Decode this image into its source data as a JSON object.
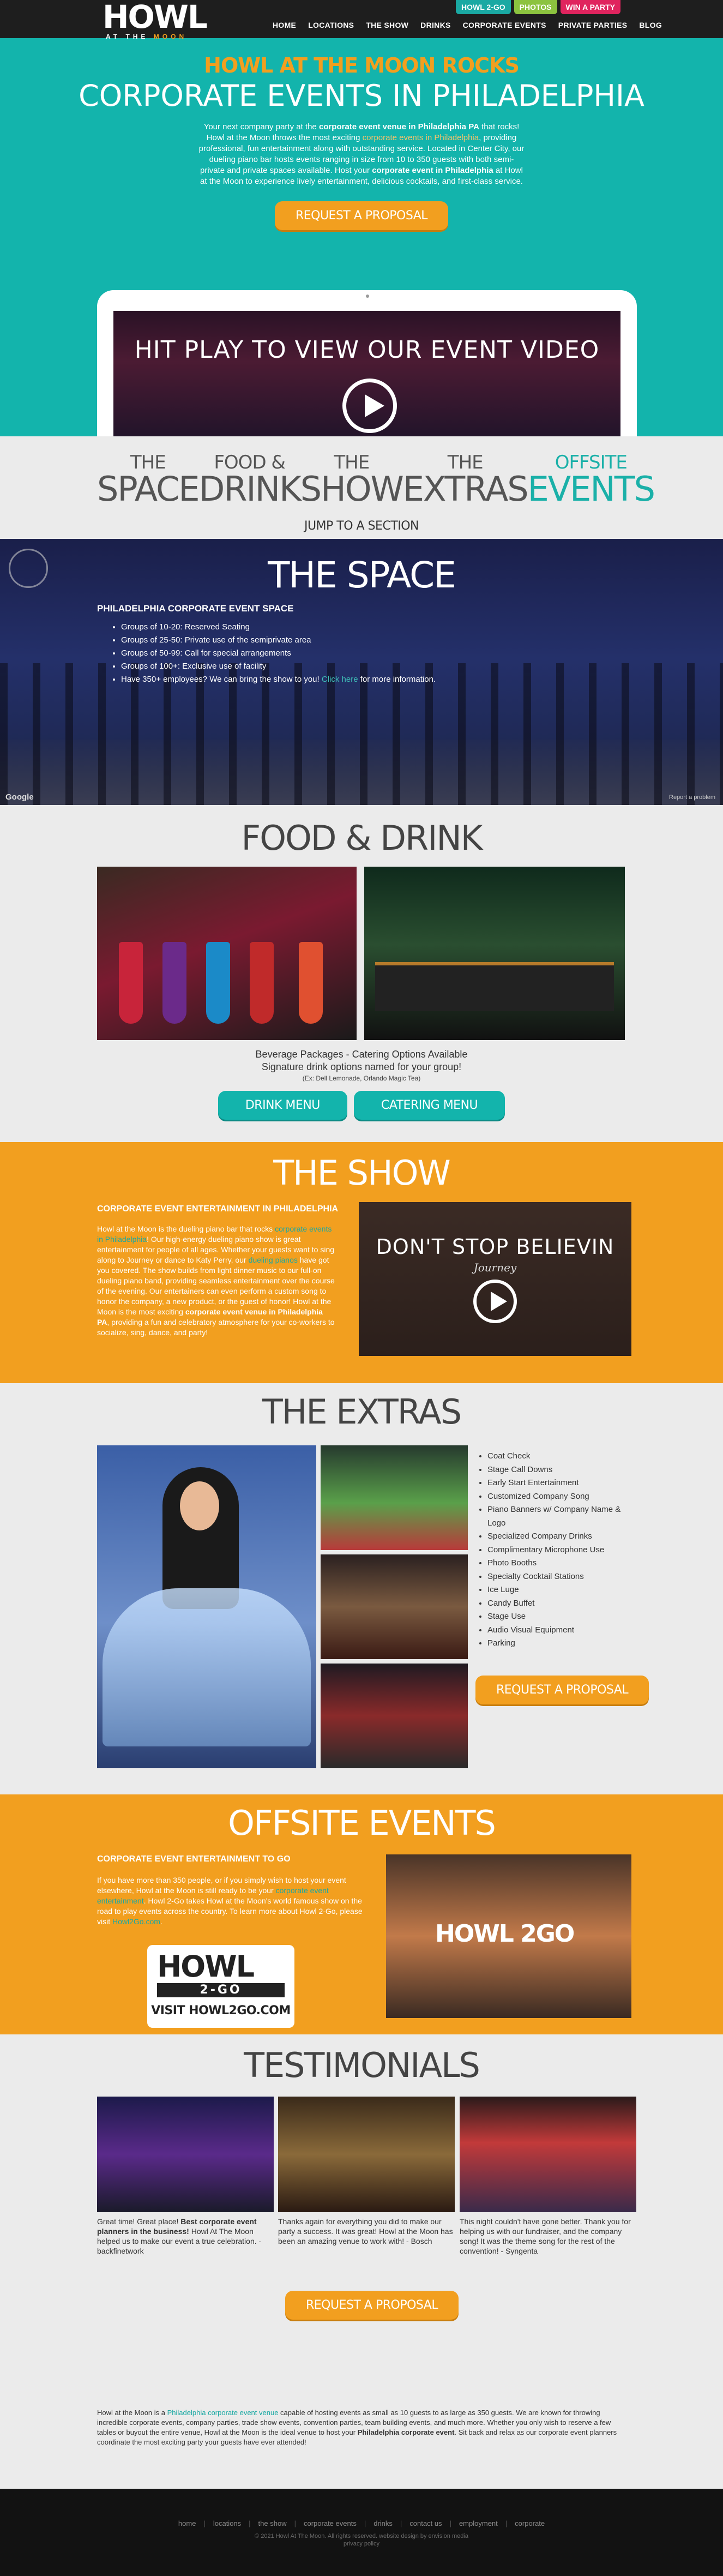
{
  "header": {
    "logo_text": "HOWL",
    "logo_sub_1": "AT THE",
    "logo_sub_2": "MOON",
    "pills": [
      "HOWL 2-GO",
      "PHOTOS",
      "WIN A PARTY"
    ],
    "nav": [
      "HOME",
      "LOCATIONS",
      "THE SHOW",
      "DRINKS",
      "CORPORATE EVENTS",
      "PRIVATE PARTIES",
      "BLOG"
    ]
  },
  "hero": {
    "kicker": "HOWL AT THE MOON ROCKS",
    "title": "CORPORATE EVENTS IN PHILADELPHIA",
    "p1": "Your next company party at the ",
    "p1b": "corporate event venue in Philadelphia PA",
    "p2": " that rocks! Howl at the Moon throws the most exciting ",
    "p2hl": "corporate events in Philadelphia",
    "p3": ", providing professional, fun entertainment along with outstanding service. Located in Center City, our dueling piano bar hosts events ranging in size from 10 to 350 guests with both semi-private and private spaces available. Host your ",
    "p3b": "corporate event in Philadelphia",
    "p4": " at Howl at the Moon to experience lively entertainment, delicious cocktails, and first-class service.",
    "button": "REQUEST A PROPOSAL",
    "video_title": "HIT PLAY TO VIEW OUR EVENT VIDEO"
  },
  "jump": {
    "items": [
      {
        "l1": "THE",
        "l2": "SPACE"
      },
      {
        "l1": "FOOD &",
        "l2": "DRINK"
      },
      {
        "l1": "THE",
        "l2": "SHOW"
      },
      {
        "l1": "THE",
        "l2": "EXTRAS"
      },
      {
        "l1": "OFFSITE",
        "l2": "EVENTS"
      }
    ],
    "label": "JUMP TO A SECTION"
  },
  "space": {
    "title": "THE SPACE",
    "subtitle": "PHILADELPHIA CORPORATE EVENT SPACE",
    "items": [
      "Groups of 10-20: Reserved Seating",
      "Groups of 25-50: Private use of the semiprivate area",
      "Groups of 50-99: Call for special arrangements",
      "Groups of 100+: Exclusive use of facility"
    ],
    "last_a": "Have 350+ employees? We can bring the show to you! ",
    "last_hl": "Click here",
    "last_b": " for more information.",
    "google": "Google",
    "report": "Report a problem"
  },
  "food": {
    "title": "FOOD & DRINK",
    "line1": "Beverage Packages - Catering Options Available",
    "line2": "Signature drink options named for your group!",
    "note": "(Ex: Dell Lemonade, Orlando Magic Tea)",
    "btn1": "DRINK MENU",
    "btn2": "CATERING MENU"
  },
  "show": {
    "title": "THE SHOW",
    "subtitle": "CORPORATE EVENT ENTERTAINMENT IN PHILADELPHIA",
    "t1": "Howl at the Moon is the dueling piano bar that rocks ",
    "t1hl": "corporate events in Philadelphia",
    "t2": "! Our high-energy dueling piano show is great entertainment for people of all ages. Whether your guests want to sing along to Journey or dance to Katy Perry, our ",
    "t2hl": "dueling pianos",
    "t3": " have got you covered. The show builds from light dinner music to our full-on dueling piano band, providing seamless entertainment over the course of the evening. Our entertainers can even perform a custom song to honor the company, a new product, or the guest of honor! Howl at the Moon is the most exciting ",
    "t3b": "corporate event venue in Philadelphia PA",
    "t4": ", providing a fun and celebratory atmosphere for your co-workers to socialize, sing, dance, and party!",
    "video_title": "DON'T STOP BELIEVIN",
    "video_sub": "Journey"
  },
  "extras": {
    "title": "THE EXTRAS",
    "items": [
      "Coat Check",
      "Stage Call Downs",
      "Early Start Entertainment",
      "Customized Company Song",
      "Piano Banners w/ Company Name & Logo",
      "Specialized Company Drinks",
      "Complimentary Microphone Use",
      "Photo Booths",
      "Specialty Cocktail Stations",
      "Ice Luge",
      "Candy Buffet",
      "Stage Use",
      "Audio Visual Equipment",
      "Parking"
    ],
    "button": "REQUEST A PROPOSAL"
  },
  "offsite": {
    "title": "OFFSITE EVENTS",
    "subtitle": "CORPORATE EVENT ENTERTAINMENT TO GO",
    "t1": "If you have more than 350 people, or if you simply wish to host your event elsewhere, Howl at the Moon is still ready to be your ",
    "t1hl": "corporate event entertainment",
    "t2": ". Howl 2-Go takes Howl at the Moon's world famous show on the road to play events across the country. To learn more about Howl 2-Go, please visit ",
    "t2hl": "Howl2Go.com",
    "t3": ".",
    "logo_top": "HOWL",
    "logo_2go": "2-GO",
    "logo_url": "VISIT HOWL2GO.COM",
    "photo_logo": "HOWL 2GO"
  },
  "testimonials": {
    "title": "TESTIMONIALS",
    "items": [
      {
        "a": "Great time! Great place! ",
        "b": "Best corporate event planners in the business!",
        "c": " Howl At The Moon helped us to make our event a true celebration. - backfinetwork"
      },
      {
        "a": "Thanks again for everything you did to make our party a success. It was great! Howl at the Moon has been an amazing venue to work with! - Bosch",
        "b": "",
        "c": ""
      },
      {
        "a": "This night couldn't have gone better. Thank you for helping us with our fundraiser, and the company song! It was the theme song for the rest of the convention! - Syngenta",
        "b": "",
        "c": ""
      }
    ],
    "button": "REQUEST A PROPOSAL"
  },
  "bottom": {
    "a": "Howl at the Moon is a ",
    "hl": "Philadelphia corporate event venue",
    "b": " capable of hosting events as small as 10 guests to as large as 350 guests. We are known for throwing incredible corporate events, company parties, trade show events, convention parties, team building events, and much more. Whether you only wish to reserve a few tables or buyout the entire venue, Howl at the Moon is the ideal venue to host your ",
    "bb": "Philadelphia corporate event",
    "c": ". Sit back and relax as our corporate event planners coordinate the most exciting party your guests have ever attended!"
  },
  "footer": {
    "links": [
      "home",
      "locations",
      "the show",
      "corporate events",
      "drinks",
      "contact us",
      "employment",
      "corporate"
    ],
    "copy1": "© 2021 Howl At The Moon. All rights reserved. website design by envision media",
    "copy2": "privacy policy"
  },
  "colors": {
    "teal": "#13b4ac",
    "orange": "#f29f1f",
    "dark": "#1e1e1e",
    "light": "#ebebeb"
  }
}
